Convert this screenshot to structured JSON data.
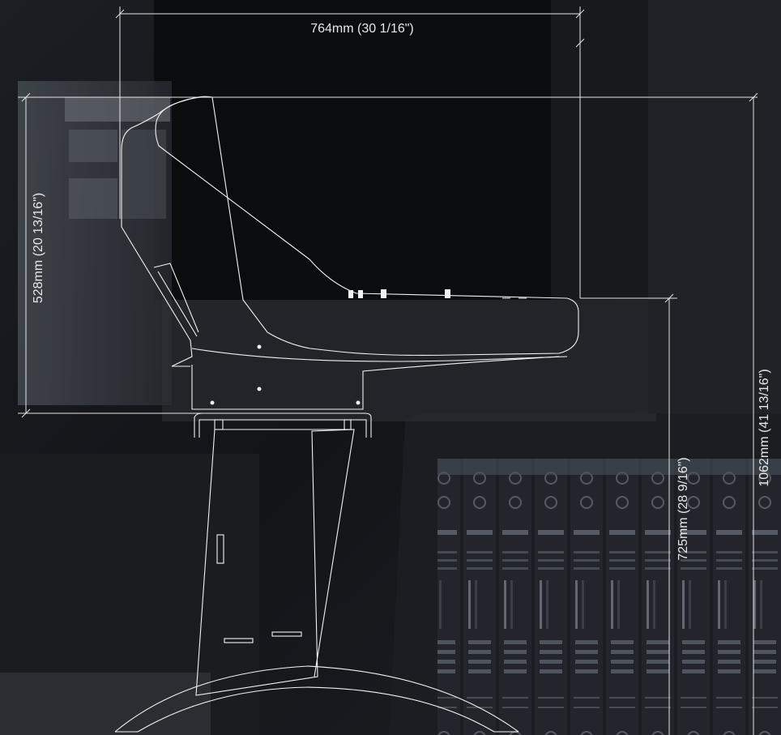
{
  "dimensions": {
    "width": "764mm (30 1/16\")",
    "upper_height": "528mm (20 13/16\")",
    "desk_height": "725mm (28 9/16\")",
    "total_height": "1062mm (41 13/16\")"
  },
  "colors": {
    "line": "#e6e6e6",
    "background": "#14161a",
    "screen_glow": "#3a3f47"
  }
}
